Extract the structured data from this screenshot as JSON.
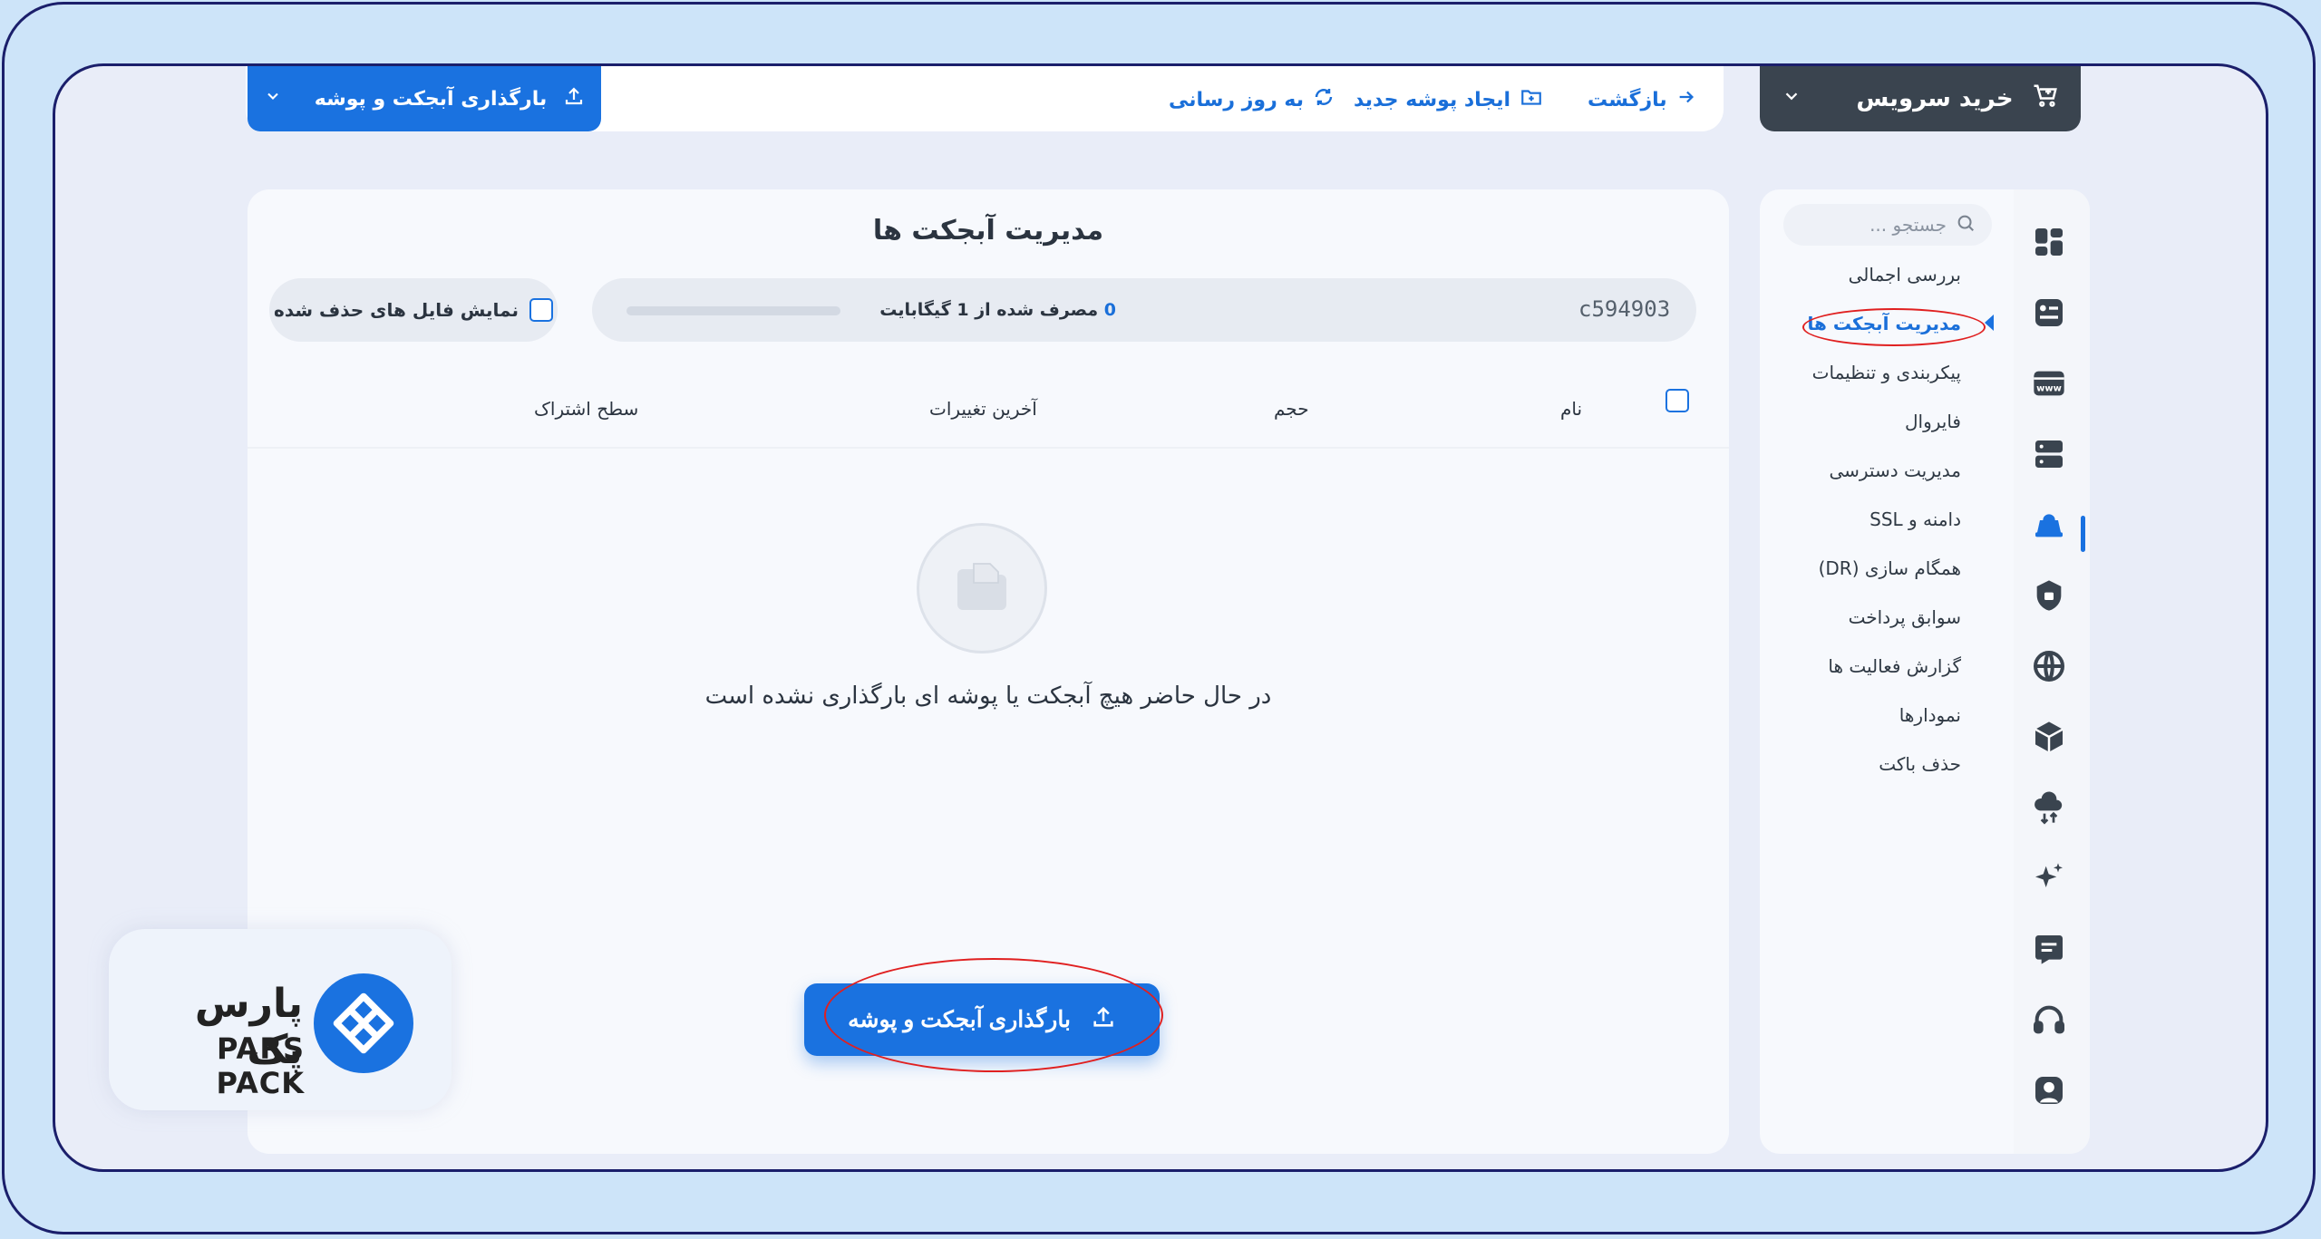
{
  "topbar": {
    "buy_service": "خرید سرویس",
    "back": "بازگشت",
    "new_folder": "ایجاد پوشه جدید",
    "refresh": "به روز رسانی",
    "upload": "بارگذاری آبجکت و پوشه"
  },
  "sidebar": {
    "search_placeholder": "جستجو ...",
    "items": [
      {
        "label": "بررسی اجمالی"
      },
      {
        "label": "مدیریت آبجکت ها"
      },
      {
        "label": "پیکربندی و تنظیمات"
      },
      {
        "label": "فایروال"
      },
      {
        "label": "مدیریت دسترسی"
      },
      {
        "label": "دامنه و SSL"
      },
      {
        "label": "همگام سازی (DR)"
      },
      {
        "label": "سوابق پرداخت"
      },
      {
        "label": "گزارش فعالیت ها"
      },
      {
        "label": "نمودارها"
      },
      {
        "label": "حذف باکت"
      }
    ],
    "active_index": 1,
    "nav_icons": [
      "dashboard-icon",
      "object-storage-icon",
      "www-icon",
      "server-icon",
      "cloud-storage-icon",
      "lock-icon",
      "network-globe-icon",
      "box-icon",
      "cloud-transfer-icon",
      "sparkle-icon",
      "ticket-icon",
      "headset-icon",
      "user-profile-icon"
    ]
  },
  "main": {
    "title": "مدیریت آبجکت ها",
    "bucket_id": "c594903",
    "usage_value": "0",
    "usage_text": "مصرف شده از 1 گیگابایت",
    "usage_fraction": 0,
    "show_deleted": "نمایش فایل های حذف شده",
    "columns": {
      "name": "نام",
      "size": "حجم",
      "modified": "آخرین تغییرات",
      "share": "سطح اشتراک"
    },
    "empty_message": "در حال حاضر هیچ آبجکت یا پوشه ای بارگذاری نشده است",
    "upload_button": "بارگذاری آبجکت و پوشه"
  },
  "logo": {
    "fa": "پارس پک",
    "en": "PARS PACK"
  },
  "colors": {
    "accent": "#1a72e0",
    "dark_button": "#3a444f",
    "highlight": "#e02020"
  }
}
